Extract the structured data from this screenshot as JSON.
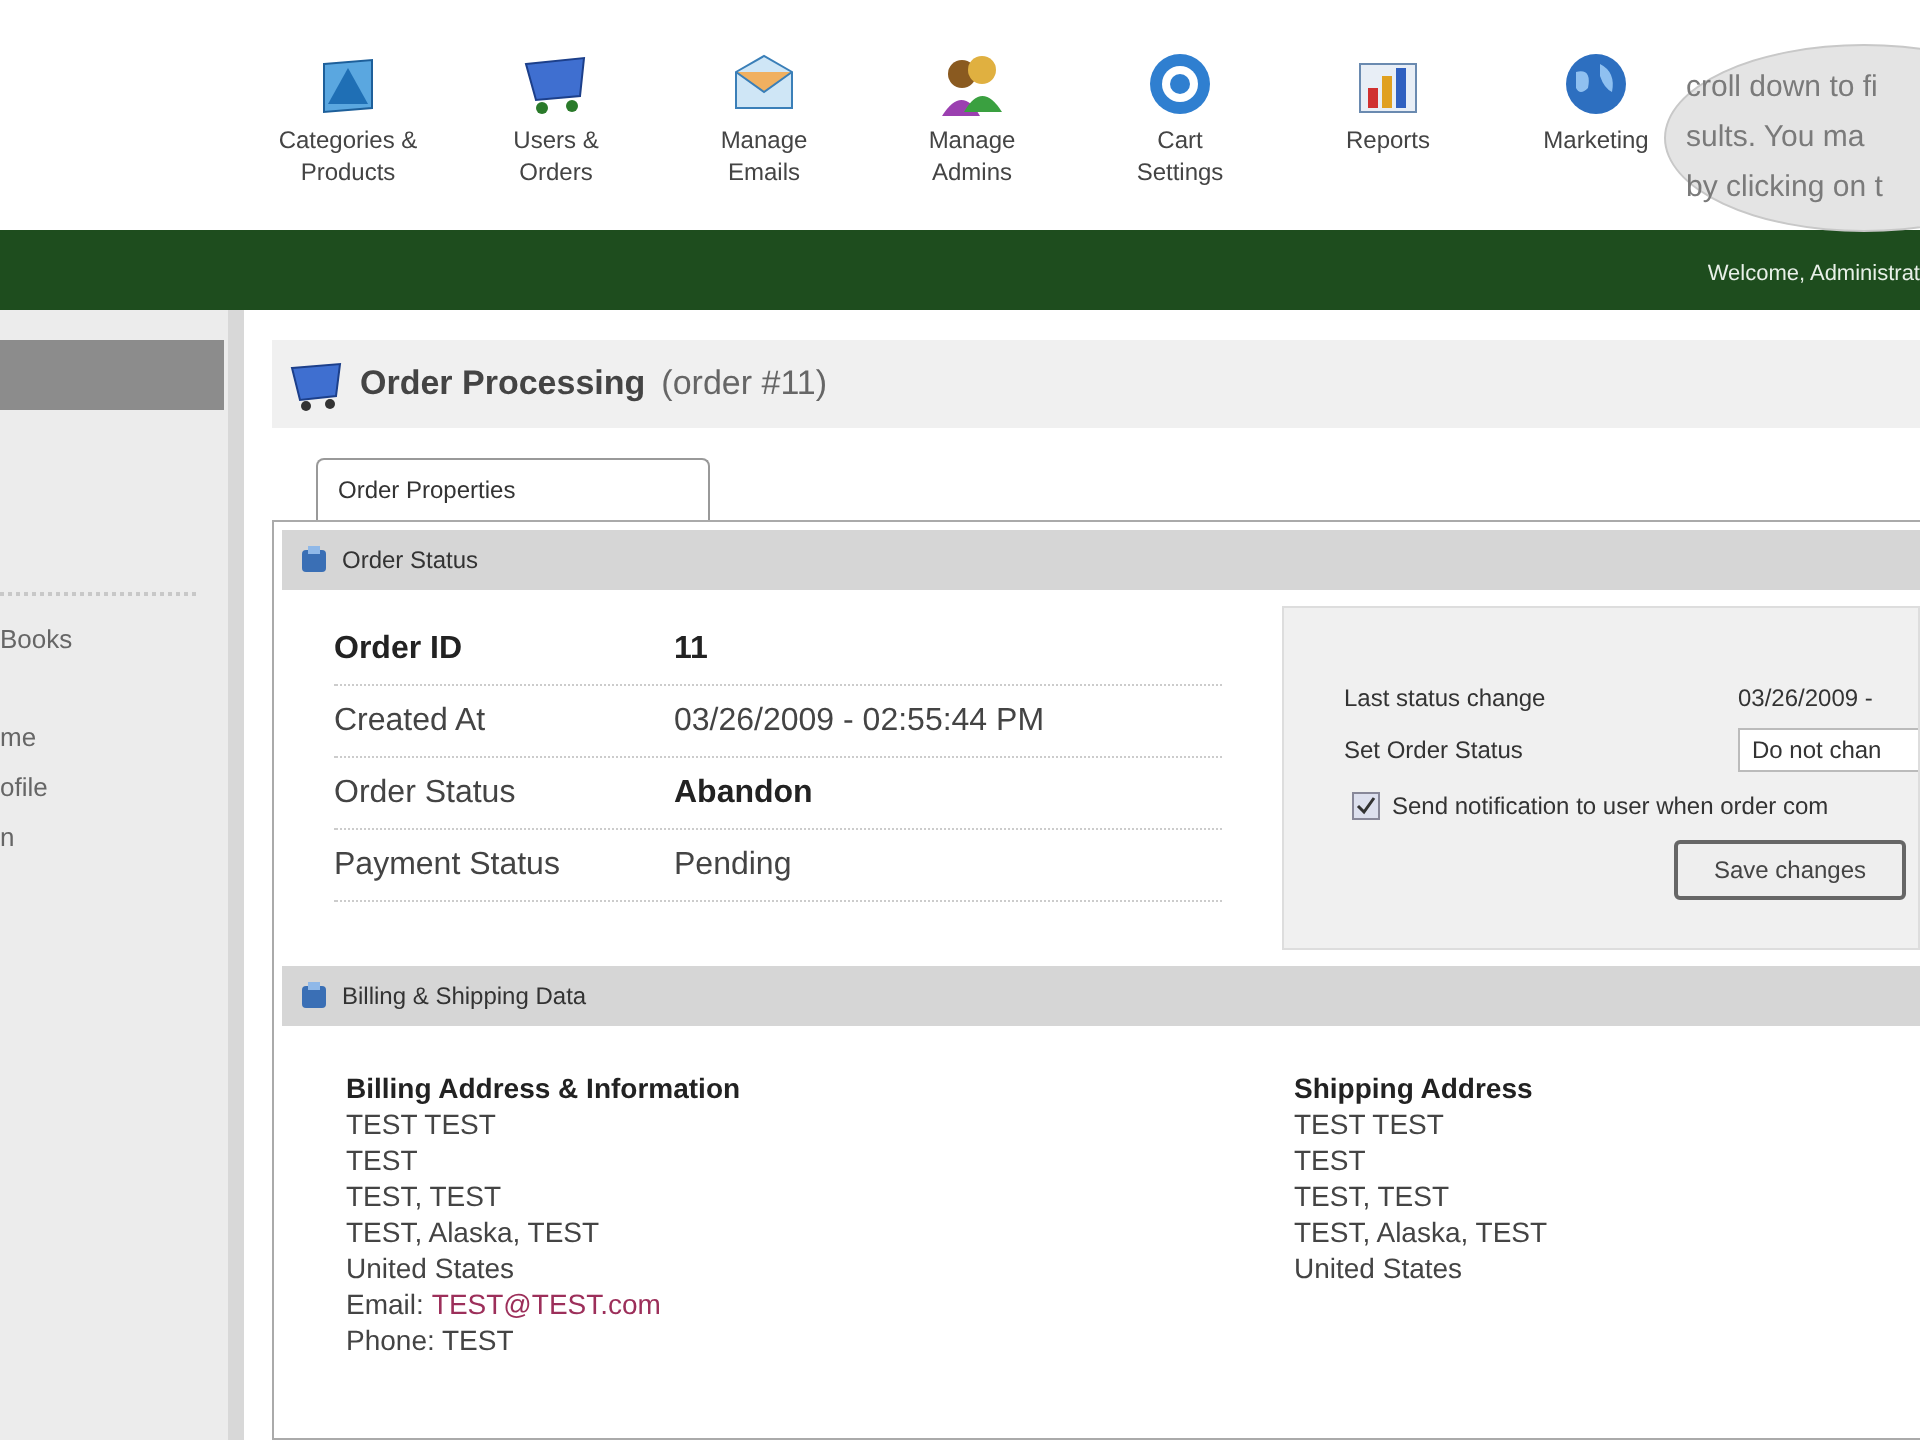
{
  "toolbar": [
    {
      "label": [
        "Categories &",
        "Products"
      ]
    },
    {
      "label": [
        "Users &",
        "Orders"
      ]
    },
    {
      "label": [
        "Manage",
        "Emails"
      ]
    },
    {
      "label": [
        "Manage",
        "Admins"
      ]
    },
    {
      "label": [
        "Cart",
        "Settings"
      ]
    },
    {
      "label": [
        "Reports"
      ]
    },
    {
      "label": [
        "Marketing"
      ]
    }
  ],
  "callout": [
    "croll down to fi",
    "sults.  You ma",
    "by clicking on t"
  ],
  "header_bar": {
    "welcome": "Welcome, Administrat"
  },
  "sidebar": {
    "items": [
      "Books",
      "me",
      "ofile",
      "n"
    ]
  },
  "page_title": {
    "title": "Order Processing",
    "subtitle": "(order #11)"
  },
  "tabs": [
    {
      "label": "Order Properties",
      "selected": true
    }
  ],
  "order_status": {
    "title": "Order Status",
    "rows": [
      {
        "label": "Order ID",
        "value": "11",
        "bold": true
      },
      {
        "label": "Created At",
        "value": "03/26/2009 - 02:55:44 PM",
        "bold": false
      },
      {
        "label": "Order Status",
        "value": "Abandon",
        "bold": true
      },
      {
        "label": "Payment Status",
        "value": "Pending",
        "bold": false
      }
    ],
    "form": {
      "last_change_label": "Last status change",
      "last_change_value": "03/26/2009 -",
      "set_status_label": "Set Order Status",
      "set_status_value": "Do not chan",
      "notify_label": "Send notification to user when order com",
      "notify_checked": true,
      "save_button": "Save changes"
    }
  },
  "billing": {
    "title": "Billing & Shipping Data",
    "billing_heading": "Billing Address & Information",
    "billing_lines": [
      "TEST TEST",
      "TEST",
      "TEST, TEST",
      "TEST, Alaska, TEST",
      "United States"
    ],
    "email_label": "Email:",
    "email": "TEST@TEST.com",
    "phone": "Phone: TEST",
    "shipping_heading": "Shipping Address",
    "shipping_lines": [
      "TEST TEST",
      "TEST",
      "TEST, TEST",
      "TEST, Alaska, TEST",
      "United States"
    ]
  }
}
